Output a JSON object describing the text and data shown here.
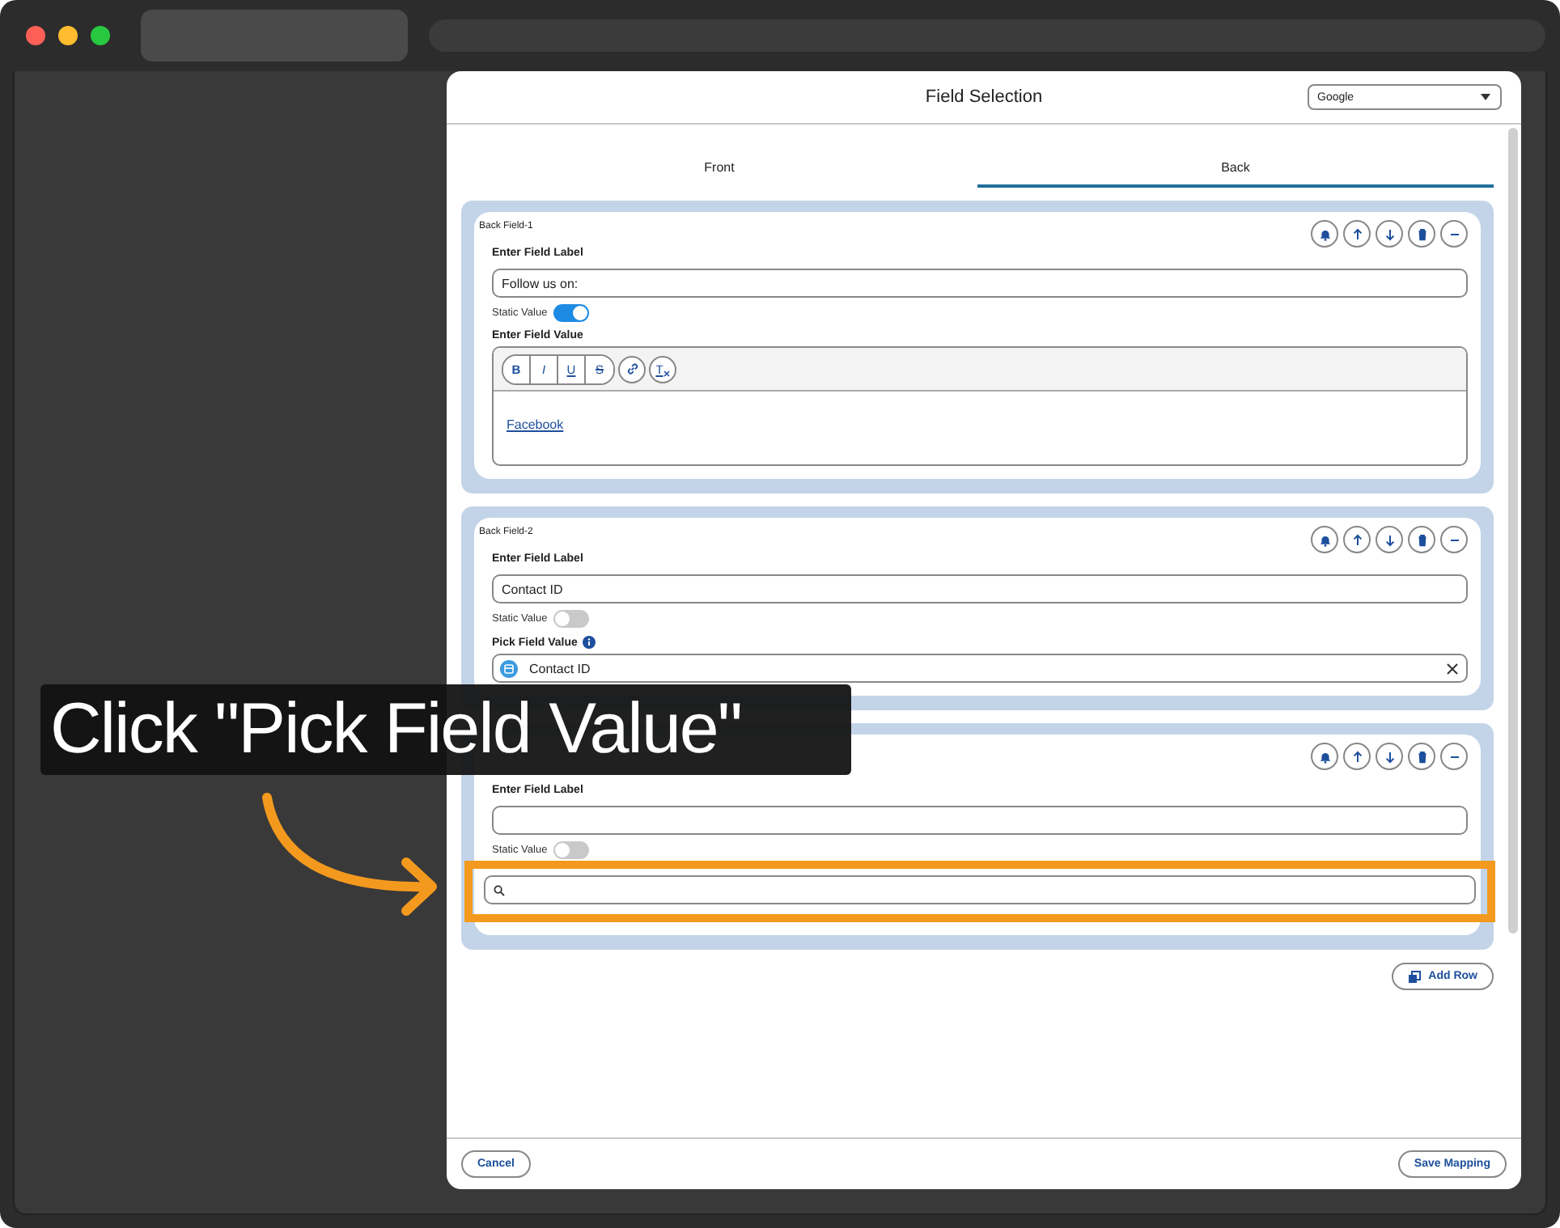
{
  "modal": {
    "title": "Field Selection",
    "source_select": {
      "value": "Google"
    },
    "tabs": [
      {
        "label": "Front",
        "selected": false
      },
      {
        "label": "Back",
        "selected": true
      }
    ],
    "fields": [
      {
        "kind": "rich",
        "name": "Back Field-1",
        "label_caption": "Enter Field Label",
        "label_value": "Follow us on:",
        "static_caption": "Static Value",
        "static_value": true,
        "value_caption": "Enter Field Value",
        "toolbar": [
          {
            "kind": "bold",
            "label": "B"
          },
          {
            "kind": "italic",
            "label": "I"
          },
          {
            "kind": "underline",
            "label": "U"
          },
          {
            "kind": "strike",
            "label": "S"
          },
          {
            "kind": "link"
          },
          {
            "kind": "clear",
            "label": "T"
          }
        ],
        "editor_link": "Facebook"
      },
      {
        "kind": "pick",
        "name": "Back Field-2",
        "label_caption": "Enter Field Label",
        "label_value": "Contact ID",
        "static_caption": "Static Value",
        "static_value": false,
        "value_caption": "Pick Field Value",
        "picked_value": "Contact ID"
      },
      {
        "kind": "search",
        "label_caption": "Enter Field Label",
        "static_caption": "Static Value",
        "static_value": false,
        "highlighted": true
      }
    ],
    "add_row": "Add Row",
    "cancel": "Cancel",
    "save": "Save Mapping"
  },
  "callout": {
    "text": "Click \"Pick Field Value\""
  }
}
